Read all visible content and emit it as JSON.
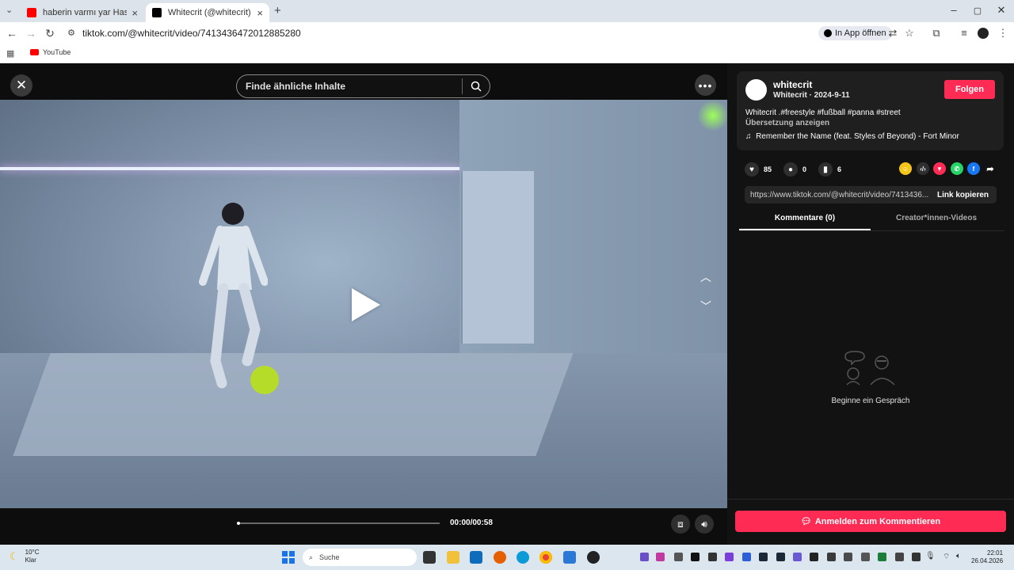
{
  "browser": {
    "tabs": [
      {
        "title": "haberin varmı yar Hasan Yıldırım",
        "favicon_color": "#ff0000"
      },
      {
        "title": "Whitecrit (@whitecrit) | TikTok",
        "favicon_color": "#000000"
      }
    ],
    "url": "tiktok.com/@whitecrit/video/7413436472012885280",
    "open_in_app": "In App öffnen",
    "bookmarks": [
      {
        "label": "YouTube"
      }
    ]
  },
  "player": {
    "search_placeholder": "Finde ähnliche Inhalte",
    "time": "00:00/00:58",
    "progress": 0
  },
  "panel": {
    "username": "whitecrit",
    "subline": "Whitecrit · 2024-9-11",
    "follow_label": "Folgen",
    "description": "Whitecrit .#freestyle #fußball #panna #street",
    "translate_label": "Übersetzung anzeigen",
    "music": "Remember the Name (feat. Styles of Beyond) - Fort Minor",
    "likes": "85",
    "comments": "0",
    "saves": "6",
    "share_icons": [
      {
        "name": "coin-icon",
        "color": "#f5c518",
        "glyph": "☺"
      },
      {
        "name": "embed-icon",
        "color": "#2f2f2f",
        "glyph": "‹/›"
      },
      {
        "name": "send-icon",
        "color": "#fe2c55",
        "glyph": "▼"
      },
      {
        "name": "whatsapp-icon",
        "color": "#25d366",
        "glyph": "✆"
      },
      {
        "name": "facebook-icon",
        "color": "#1877f2",
        "glyph": "f"
      },
      {
        "name": "share-arrow-icon",
        "color": "#121212",
        "glyph": "➦"
      }
    ],
    "link_url": "https://www.tiktok.com/@whitecrit/video/7413436...",
    "copy_link_label": "Link kopieren",
    "tab_comments": "Kommentare (0)",
    "tab_creator_videos": "Creator*innen-Videos",
    "empty_text": "Beginne ein Gespräch",
    "login_comment_label": "Anmelden zum Kommentieren"
  },
  "taskbar": {
    "temp": "10°C",
    "condition": "Klar",
    "search_label": "Suche",
    "time": "22:01",
    "date": "26.04.2026"
  }
}
